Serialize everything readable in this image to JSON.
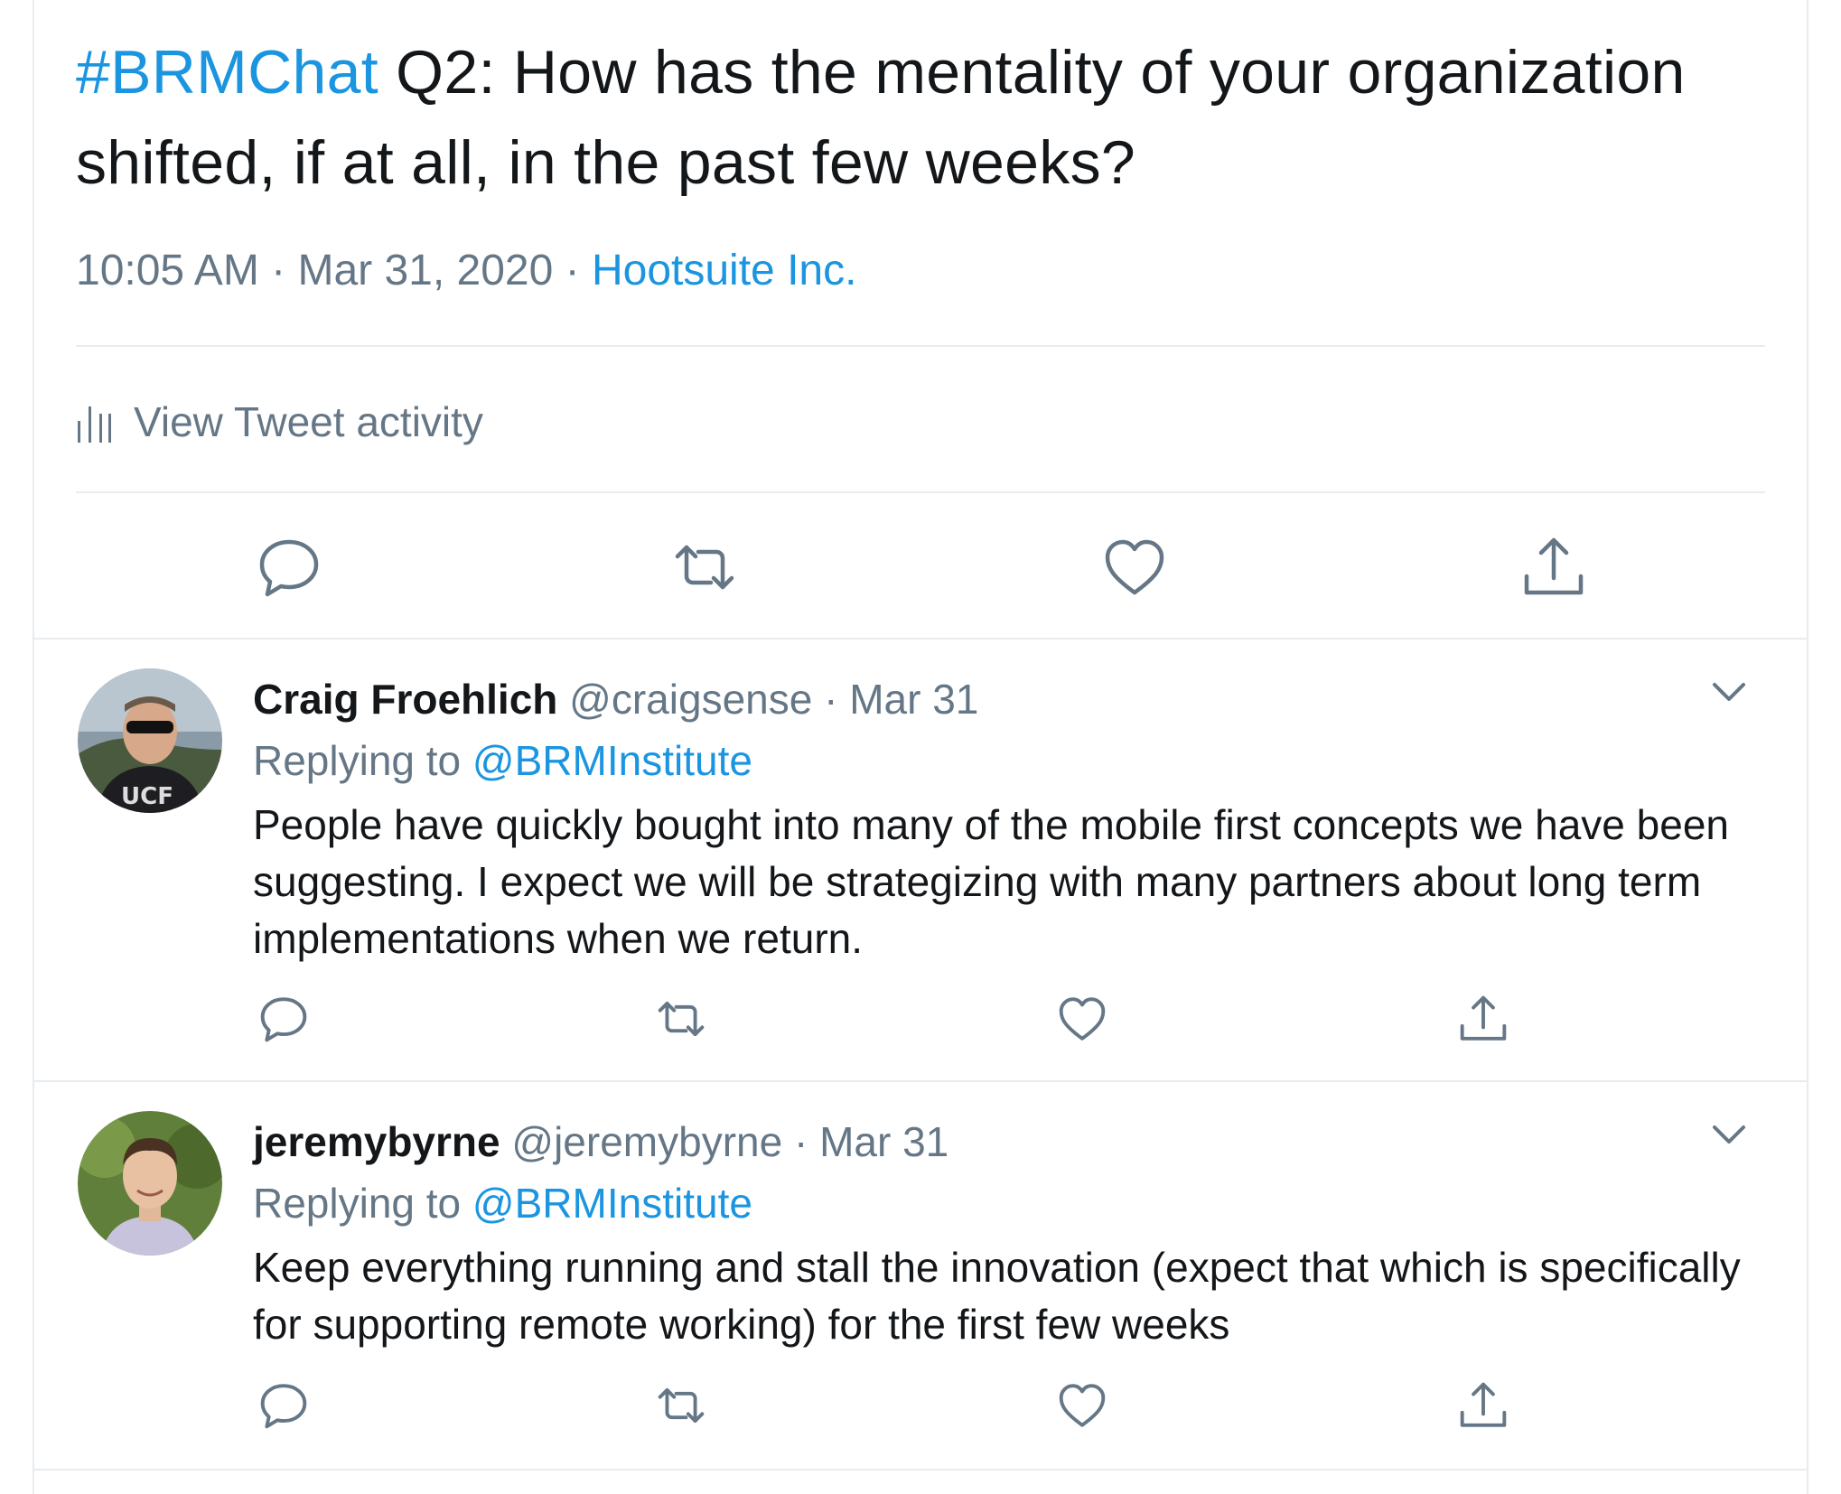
{
  "main_tweet": {
    "hashtag": "#BRMChat",
    "text": " Q2: How has the mentality of your organization shifted, if at all, in the past few weeks?",
    "time": "10:05 AM",
    "date": "Mar 31, 2020",
    "source": "Hootsuite Inc.",
    "separator": " · ",
    "activity_label": "View Tweet activity"
  },
  "replies": [
    {
      "name": "Craig Froehlich",
      "handle": "@craigsense",
      "date": "Mar 31",
      "replying_prefix": "Replying to ",
      "replying_to": "@BRMInstitute",
      "text": "People have quickly bought into many of the mobile first concepts we have been suggesting.  I expect we will be strategizing with many partners about long term implementations when we return."
    },
    {
      "name": "jeremybyrne",
      "handle": "@jeremybyrne",
      "date": "Mar 31",
      "replying_prefix": "Replying to ",
      "replying_to": "@BRMInstitute",
      "text": "Keep everything running and stall the innovation (expect that which is specifically for supporting remote working) for the first few weeks"
    }
  ],
  "icons": {
    "reply": "speech-bubble-icon",
    "retweet": "retweet-icon",
    "like": "heart-icon",
    "share": "share-icon",
    "caret": "chevron-down-icon",
    "activity": "bar-chart-icon"
  },
  "colors": {
    "link": "#1b95e0",
    "secondary_text": "#657786",
    "primary_text": "#14171a",
    "divider": "#e6ecf0"
  }
}
